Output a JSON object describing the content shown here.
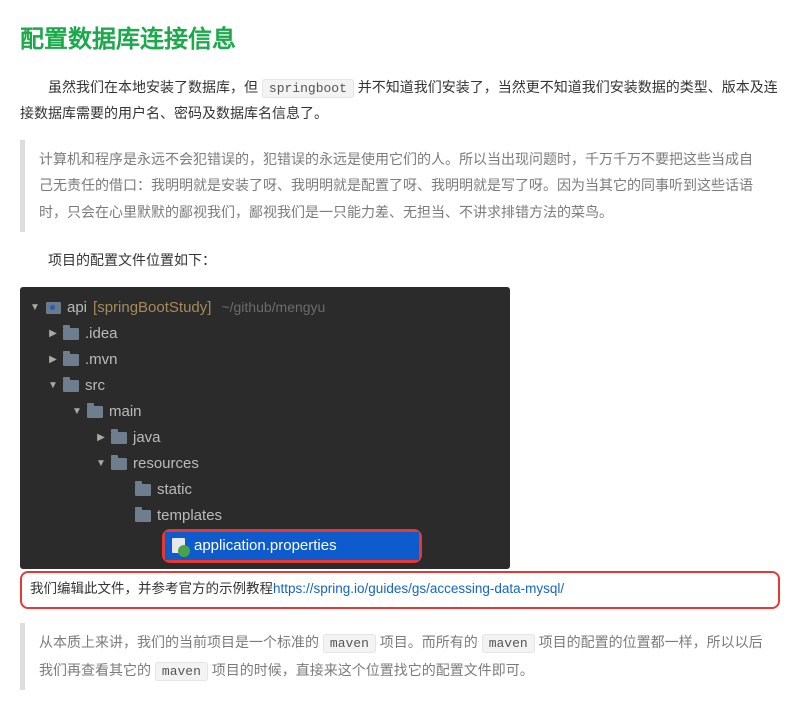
{
  "heading": "配置数据库连接信息",
  "para1": {
    "seg1": "虽然我们在本地安装了数据库，但 ",
    "code1": "springboot",
    "seg2": " 并不知道我们安装了，当然更不知道我们安装数据的类型、版本及连接数据库需要的用户名、密码及数据库名信息了。"
  },
  "quote1": "计算机和程序是永远不会犯错误的，犯错误的永远是使用它们的人。所以当出现问题时，千万千万不要把这些当成自己无责任的借口：我明明就是安装了呀、我明明就是配置了呀、我明明就是写了呀。因为当其它的同事听到这些话语时，只会在心里默默的鄙视我们，鄙视我们是一只能力差、无担当、不讲求排错方法的菜鸟。",
  "locLine": "项目的配置文件位置如下：",
  "ide": {
    "root": {
      "name": "api",
      "project": "[springBootStudy]",
      "path": "~/github/mengyu"
    },
    "items": [
      {
        "indent": 26,
        "arrow": "right",
        "icon": "folder",
        "label": ".idea"
      },
      {
        "indent": 26,
        "arrow": "right",
        "icon": "folder",
        "label": ".mvn"
      },
      {
        "indent": 26,
        "arrow": "down",
        "icon": "folder",
        "label": "src"
      },
      {
        "indent": 50,
        "arrow": "down",
        "icon": "folder",
        "label": "main"
      },
      {
        "indent": 74,
        "arrow": "right",
        "icon": "folder",
        "label": "java"
      },
      {
        "indent": 74,
        "arrow": "down",
        "icon": "folder",
        "label": "resources"
      },
      {
        "indent": 98,
        "arrow": "",
        "icon": "folder",
        "label": "static"
      },
      {
        "indent": 98,
        "arrow": "",
        "icon": "folder",
        "label": "templates"
      }
    ],
    "selected": {
      "label": "application.properties"
    }
  },
  "caption": {
    "text": "我们编辑此文件，并参考官方的示例教程",
    "link": "https://spring.io/guides/gs/accessing-data-mysql/"
  },
  "quote2": {
    "seg1": "从本质上来讲，我们的当前项目是一个标准的 ",
    "code1": "maven",
    "seg2": " 项目。而所有的 ",
    "code2": "maven",
    "seg3": " 项目的配置的位置都一样，所以以后我们再查看其它的 ",
    "code3": "maven",
    "seg4": " 项目的时候，直接来这个位置找它的配置文件即可。"
  }
}
